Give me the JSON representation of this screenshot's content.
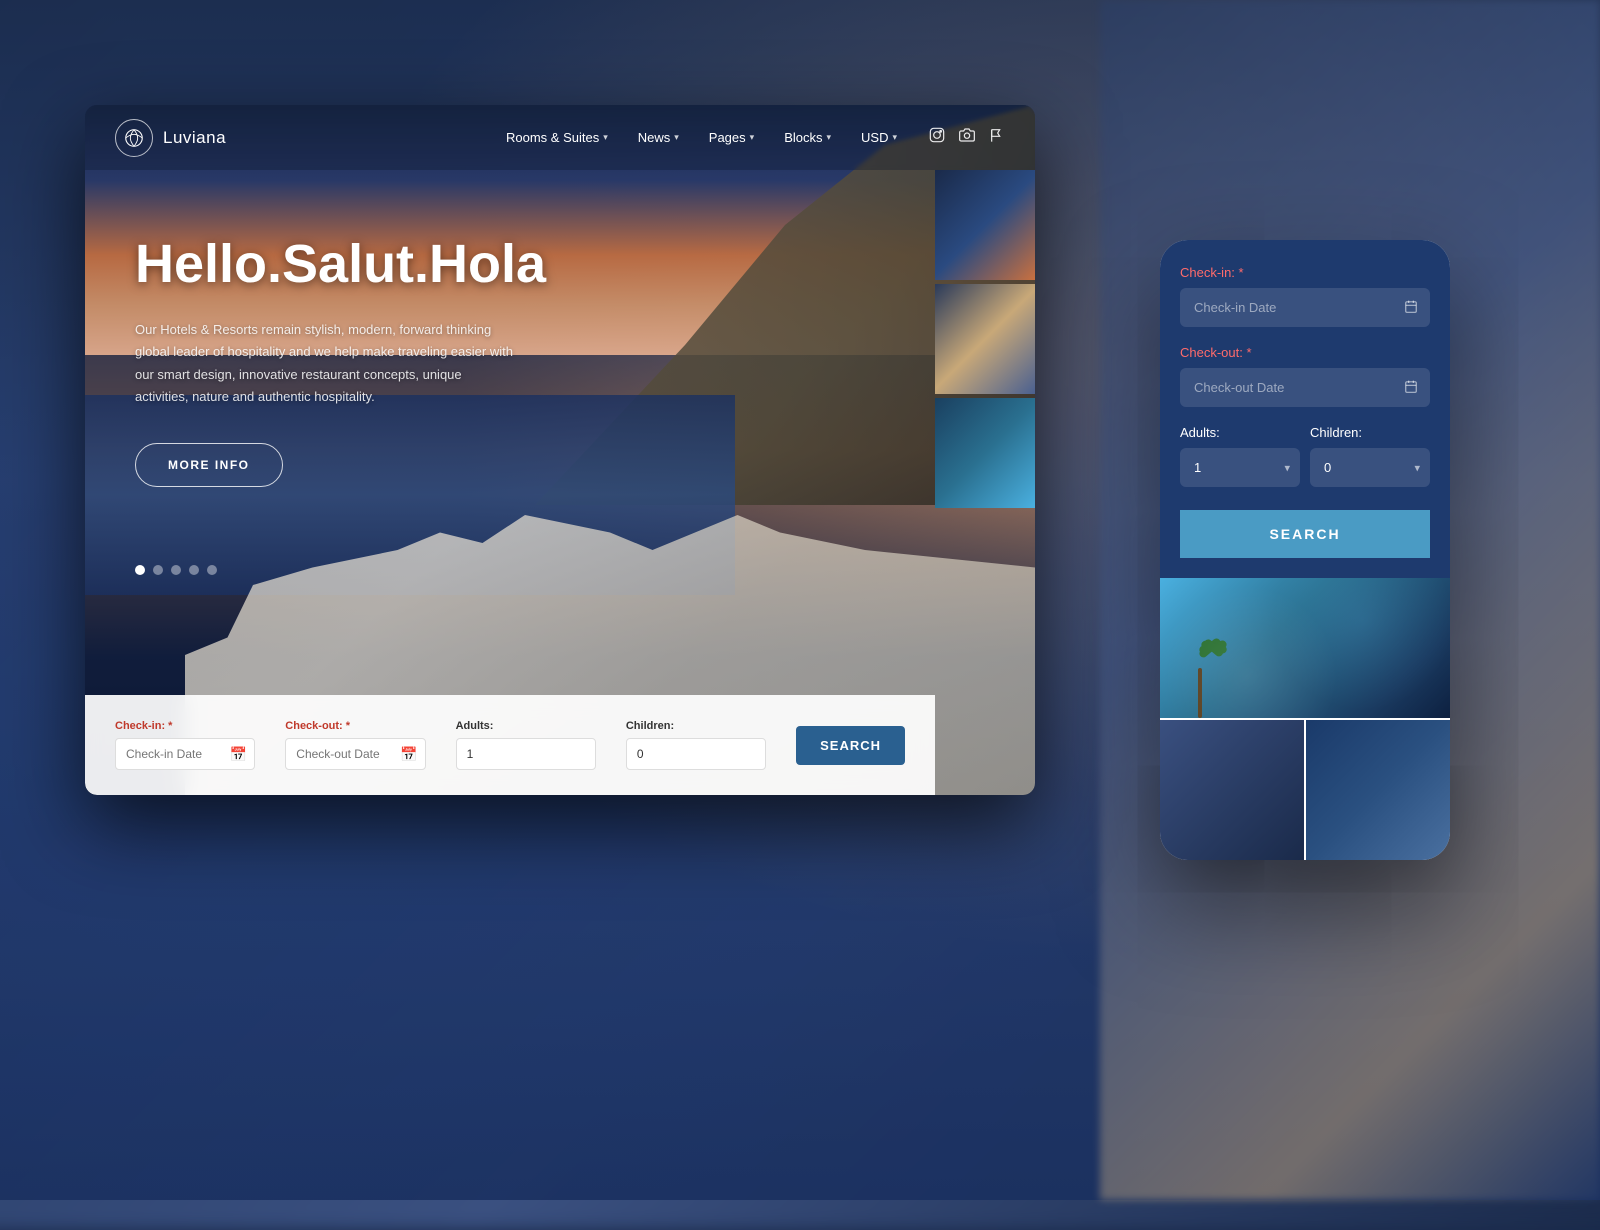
{
  "page": {
    "background": {
      "description": "Blurred hotel/resort background image"
    }
  },
  "desktop": {
    "navbar": {
      "logo_text": "Luviana",
      "nav_items": [
        {
          "label": "Rooms & Suites",
          "has_dropdown": true
        },
        {
          "label": "News",
          "has_dropdown": true
        },
        {
          "label": "Pages",
          "has_dropdown": true
        },
        {
          "label": "Blocks",
          "has_dropdown": true
        },
        {
          "label": "USD",
          "has_dropdown": true
        }
      ],
      "social_icons": [
        "instagram",
        "camera",
        "flag"
      ]
    },
    "hero": {
      "title": "Hello.Salut.Hola",
      "description": "Our Hotels & Resorts remain stylish, modern, forward thinking global leader of hospitality and we help make traveling easier with our smart design, innovative restaurant concepts, unique activities, nature and authentic hospitality.",
      "cta_button": "MORE INFO",
      "carousel_dots": [
        true,
        false,
        false,
        false,
        false
      ],
      "thumbnails": [
        "cliff-sunset",
        "dining-terrace",
        "pool-aerial"
      ]
    },
    "booking_bar": {
      "checkin_label": "Check-in:",
      "checkin_required": "*",
      "checkin_placeholder": "Check-in Date",
      "checkout_label": "Check-out:",
      "checkout_required": "*",
      "checkout_placeholder": "Check-out Date",
      "adults_label": "Adults:",
      "adults_default": "1",
      "children_label": "Children:",
      "children_default": "0",
      "search_button": "SEARCH"
    }
  },
  "mobile": {
    "form": {
      "checkin_label": "Check-in:",
      "checkin_required": "*",
      "checkin_placeholder": "Check-in Date",
      "checkout_label": "Check-out:",
      "checkout_required": "*",
      "checkout_placeholder": "Check-out Date",
      "adults_label": "Adults:",
      "adults_default": "1",
      "children_label": "Children:",
      "children_default": "0",
      "search_button": "SEARCH"
    }
  }
}
